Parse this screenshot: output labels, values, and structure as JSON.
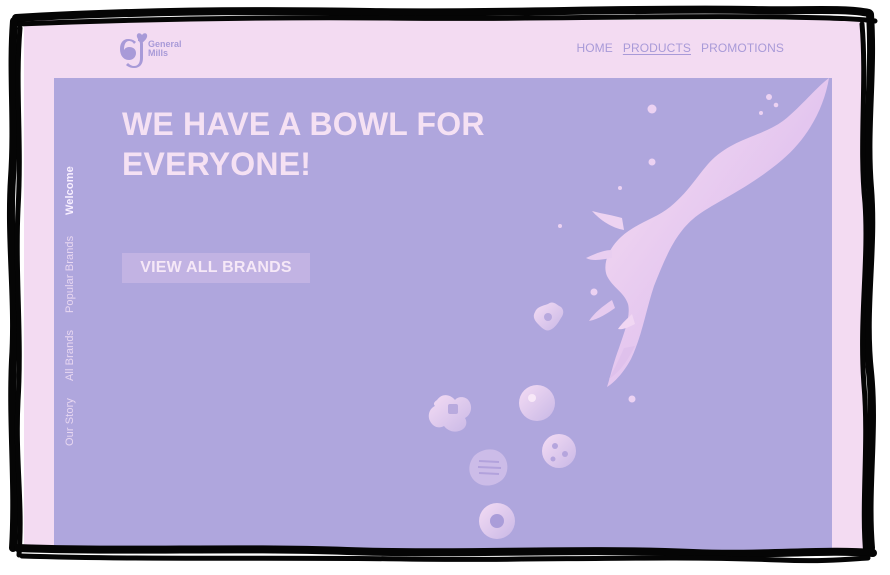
{
  "brand": {
    "name_line_1": "General",
    "name_line_2": "Mills"
  },
  "nav": {
    "home": "HOME",
    "products": "PRODUCTS",
    "promotions": "PROMOTIONS"
  },
  "side_nav": {
    "items": [
      "Welcome",
      "Popular Brands",
      "All Brands",
      "Our Story"
    ]
  },
  "hero": {
    "title": "WE HAVE A BOWL FOR EVERYONE!",
    "cta": "VIEW ALL BRANDS"
  },
  "colors": {
    "page_bg": "#f3dbf2",
    "hero_bg": "#afa6dd",
    "accent_text": "#f5e1f3",
    "nav_text": "#a89ad8"
  }
}
